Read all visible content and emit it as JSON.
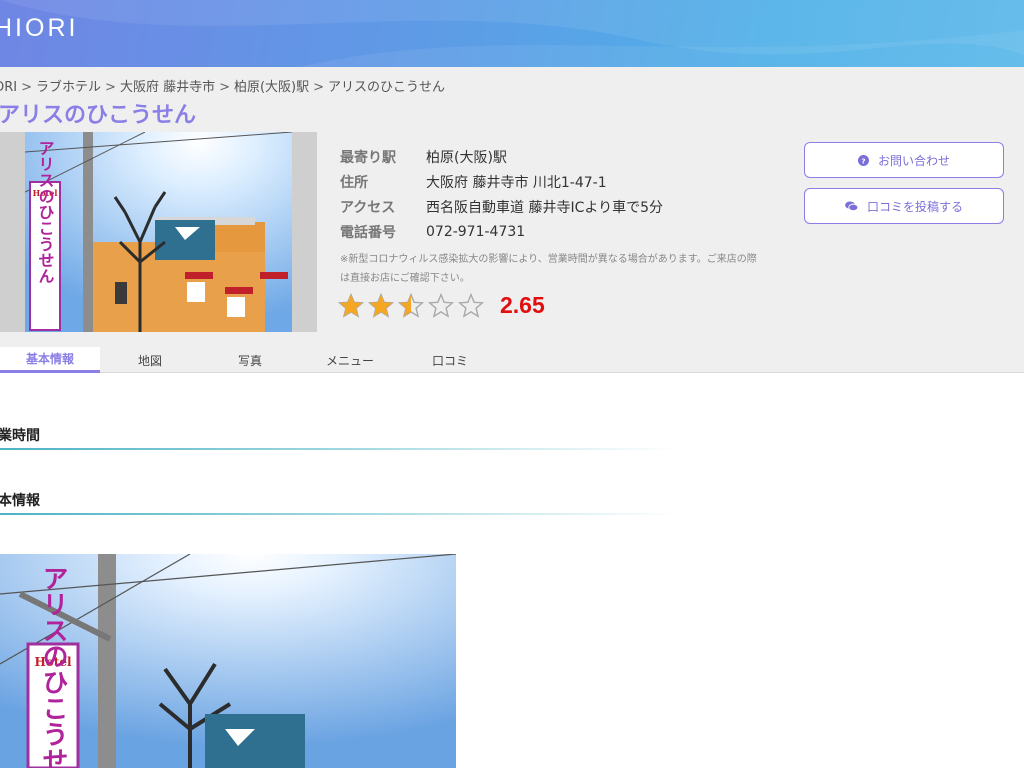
{
  "header": {
    "logo": "HIORI"
  },
  "breadcrumb": [
    "ORI",
    "ラブホテル",
    "大阪府 藤井寺市",
    "柏原(大阪)駅",
    "アリスのひこうせん"
  ],
  "breadcrumb_separator": ">",
  "hotel": {
    "name": "アリスのひこうせん",
    "photo_sign_text": "アリスのひこうせん",
    "photo_sign_hotel": "Hotel"
  },
  "details": [
    {
      "label": "最寄り駅",
      "value": "柏原(大阪)駅"
    },
    {
      "label": "住所",
      "value": "大阪府 藤井寺市 川北1-47-1"
    },
    {
      "label": "アクセス",
      "value": "西名阪自動車道 藤井寺ICより車で5分"
    },
    {
      "label": "電話番号",
      "value": "072-971-4731"
    }
  ],
  "notice": "※新型コロナウィルス感染拡大の影響により、営業時間が異なる場合があります。ご来店の際は直接お店にご確認下さい。",
  "rating": {
    "value": "2.65",
    "score": 2.65,
    "max": 5
  },
  "buttons": {
    "contact": "お問い合わせ",
    "review": "口コミを投稿する"
  },
  "tabs": [
    {
      "label": "基本情報",
      "active": true
    },
    {
      "label": "地図",
      "active": false
    },
    {
      "label": "写真",
      "active": false
    },
    {
      "label": "メニュー",
      "active": false
    },
    {
      "label": "口コミ",
      "active": false
    }
  ],
  "sections": {
    "hours": "営業時間",
    "basic_info": "基本情報"
  },
  "colors": {
    "accent": "#8a7fe6",
    "rating": "#e00e0e",
    "star": "#f5a623"
  },
  "icons": {
    "contact": "question-circle-icon",
    "review": "comments-icon"
  }
}
